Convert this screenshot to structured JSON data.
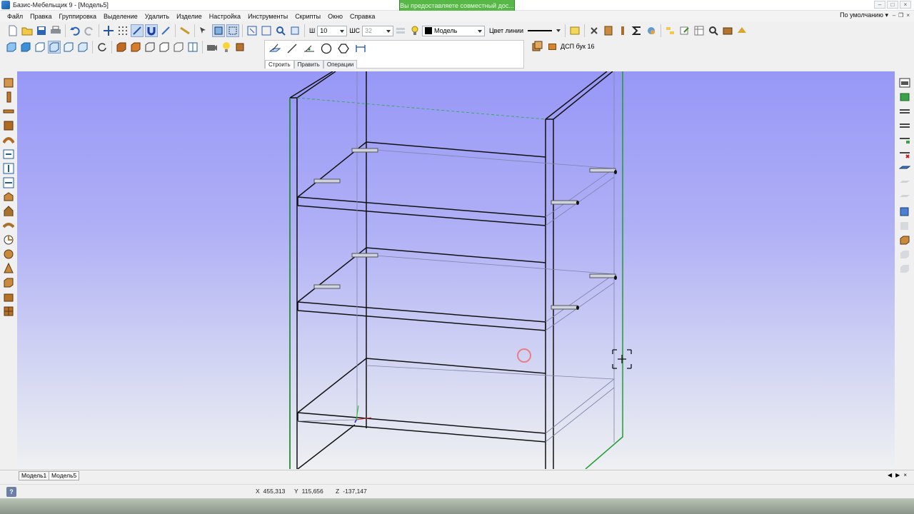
{
  "window": {
    "title": "Базис-Мебельщик 9 - [Модель5]",
    "share_notice": "Вы предоставляете совместный дос..."
  },
  "menu": [
    "Файл",
    "Правка",
    "Группировка",
    "Выделение",
    "Удалить",
    "Изделие",
    "Настройка",
    "Инструменты",
    "Скрипты",
    "Окно",
    "Справка"
  ],
  "preset": "По умолчанию",
  "toolbar": {
    "w_label": "Ш",
    "w_value": "10",
    "ws_label": "ШС",
    "ws_value": "32",
    "layer_value": "Модель",
    "line_color_label": "Цвет линии"
  },
  "draw_panel": {
    "tabs": [
      "Строить",
      "Править",
      "Операции"
    ],
    "active_tab": "Строить"
  },
  "material": "ДСП бук 16",
  "doc_tabs": [
    "Модель1",
    "Модель5"
  ],
  "status": {
    "x_label": "X",
    "x_value": "455,313",
    "y_label": "Y",
    "y_value": "115,656",
    "z_label": "Z",
    "z_value": "-137,147"
  },
  "colors": {
    "panel_edge": "#1f9e2e",
    "outline": "#111111",
    "hidden": "#7f84a8",
    "cursor_circle": "#ef6a6a"
  }
}
